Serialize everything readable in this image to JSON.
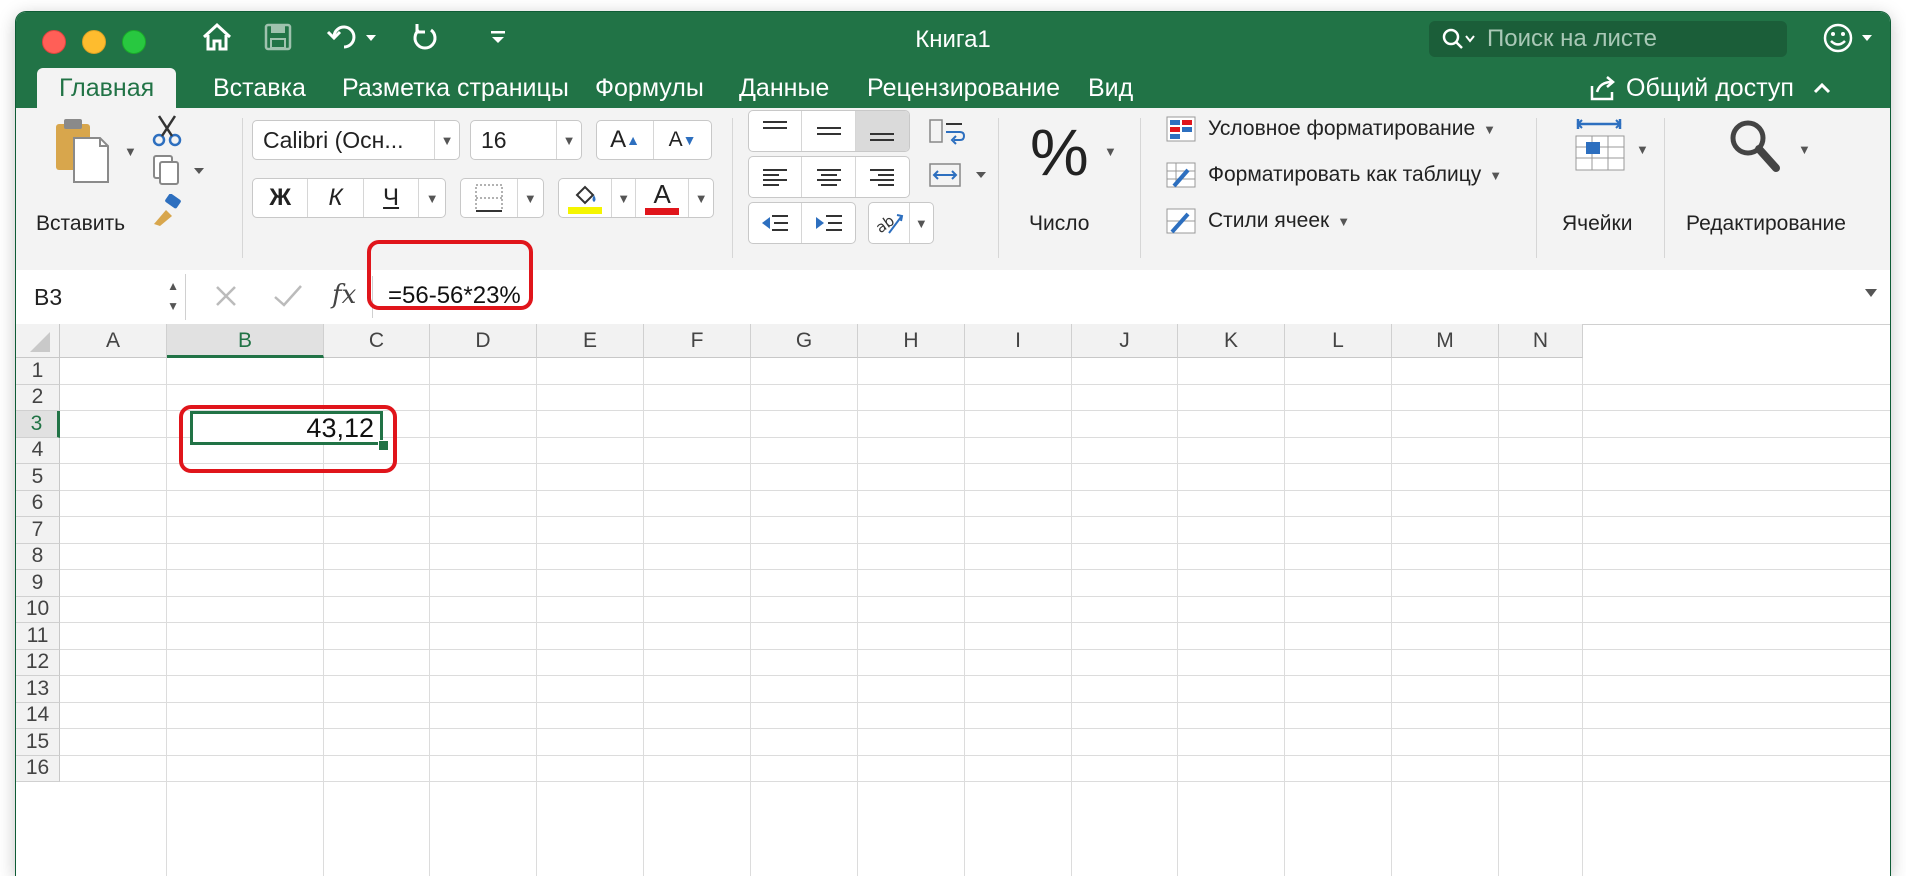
{
  "window": {
    "title": "Книга1"
  },
  "search": {
    "placeholder": "Поиск на листе"
  },
  "tabs": [
    "Главная",
    "Вставка",
    "Разметка страницы",
    "Формулы",
    "Данные",
    "Рецензирование",
    "Вид"
  ],
  "active_tab": "Главная",
  "share_label": "Общий доступ",
  "ribbon": {
    "paste_label": "Вставить",
    "font_name": "Calibri (Осн...",
    "font_size": "16",
    "increase_font": "A",
    "decrease_font": "A",
    "bold": "Ж",
    "italic": "К",
    "underline": "Ч",
    "font_color_glyph": "A",
    "percent_glyph": "%",
    "number_label": "Число",
    "conditional_formatting": "Условное форматирование",
    "format_as_table": "Форматировать как таблицу",
    "cell_styles": "Стили ячеек",
    "cells_label": "Ячейки",
    "editing_label": "Редактирование"
  },
  "formula_bar": {
    "name_box": "B3",
    "fx_label": "fx",
    "formula": "=56-56*23%"
  },
  "sheet": {
    "columns": [
      "A",
      "B",
      "C",
      "D",
      "E",
      "F",
      "G",
      "H",
      "I",
      "J",
      "K",
      "L",
      "M",
      "N"
    ],
    "rows": [
      "1",
      "2",
      "3",
      "4",
      "5",
      "6",
      "7",
      "8",
      "9",
      "10",
      "11",
      "12",
      "13",
      "14",
      "15",
      "16"
    ],
    "selected_column": "B",
    "selected_row": "3",
    "active_cell_value": "43,12"
  },
  "colors": {
    "excel_green": "#217346",
    "highlight_red": "#e0151b",
    "fill_color": "#f5f500",
    "font_color": "#e0151b"
  },
  "icons": [
    "home-icon",
    "save-icon",
    "undo-icon",
    "redo-icon",
    "customize-icon",
    "search-icon",
    "smiley-icon",
    "share-icon",
    "scissors-icon",
    "copy-icon",
    "format-painter-icon",
    "border-icon",
    "fill-color-icon",
    "font-color-icon",
    "wrap-text-icon",
    "merge-icon",
    "orientation-icon",
    "cells-icon",
    "magnifier-icon"
  ]
}
